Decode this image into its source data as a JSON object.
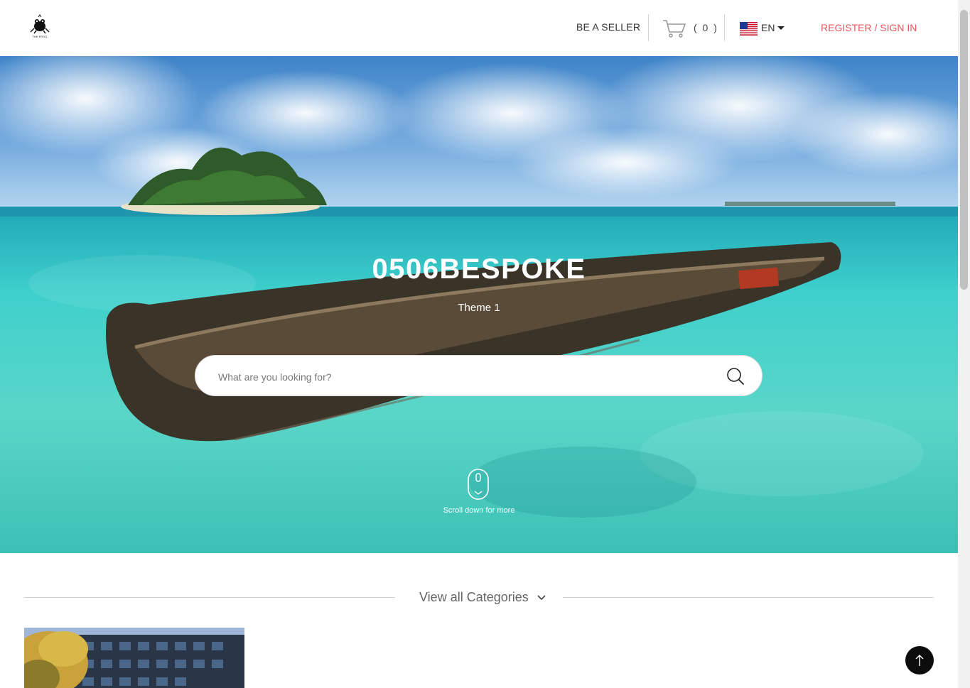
{
  "header": {
    "logo_text": "THE FROG",
    "be_seller": "BE A SELLER",
    "cart_count": "( 0 )",
    "language": "EN",
    "register": "REGISTER / SIGN IN"
  },
  "hero": {
    "title": "0506BESPOKE",
    "subtitle": "Theme 1",
    "search_placeholder": "What are you looking for?",
    "scroll_text": "Scroll down for more"
  },
  "categories": {
    "view_all": "View all Categories"
  },
  "colors": {
    "accent": "#e8565e",
    "to_top_bg": "#0c0c0c"
  },
  "icons": [
    "cart-icon",
    "us-flag-icon",
    "search-icon",
    "mouse-scroll-icon",
    "chevron-down-icon",
    "arrow-up-icon"
  ]
}
